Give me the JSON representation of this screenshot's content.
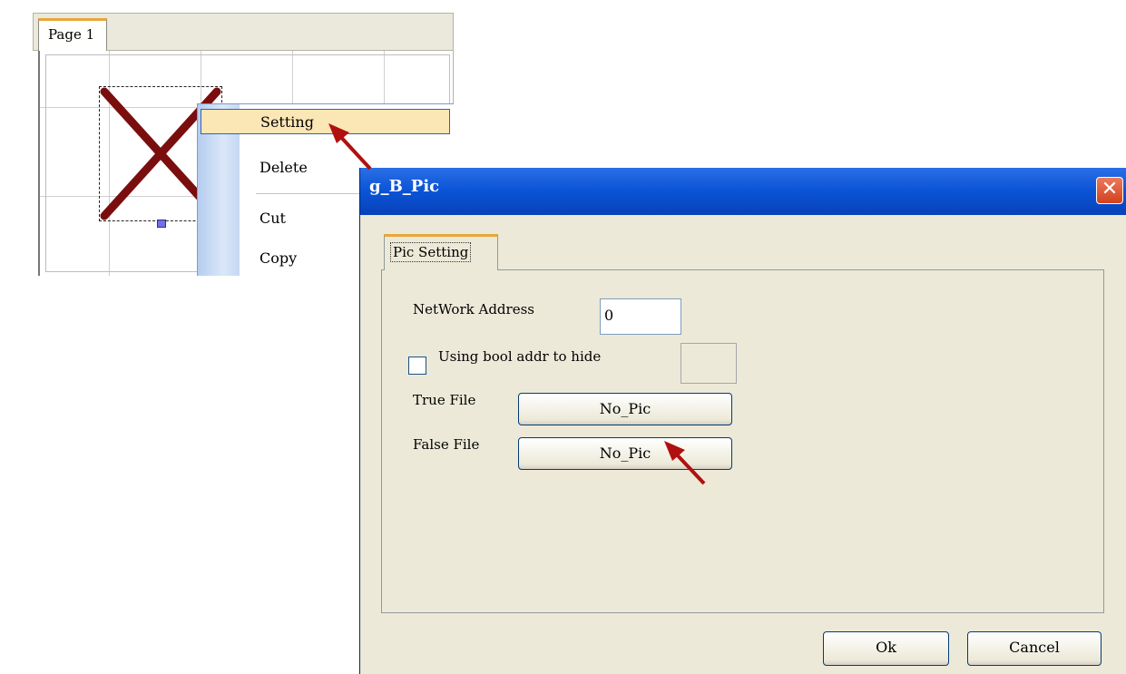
{
  "editor": {
    "page_tab": "Page 1"
  },
  "context_menu": {
    "items": [
      {
        "label": "Setting",
        "highlighted": true
      },
      {
        "label": "Delete"
      },
      {
        "label": "Cut"
      },
      {
        "label": "Copy"
      }
    ]
  },
  "dialog": {
    "title": "g_B_Pic",
    "tab": "Pic Setting",
    "network_address_label": "NetWork Address",
    "network_address_value": "0",
    "hide_checkbox_label": "Using bool addr to hide",
    "hide_checkbox_checked": false,
    "true_file_label": "True File",
    "true_file_button": "No_Pic",
    "false_file_label": "False File",
    "false_file_button": "No_Pic",
    "ok_label": "Ok",
    "cancel_label": "Cancel"
  },
  "colors": {
    "title_bar": "#0a53d6",
    "dialog_bg": "#ece9d8",
    "tab_accent": "#e8a63a",
    "arrow": "#b01010",
    "cross": "#7a0e0e"
  }
}
